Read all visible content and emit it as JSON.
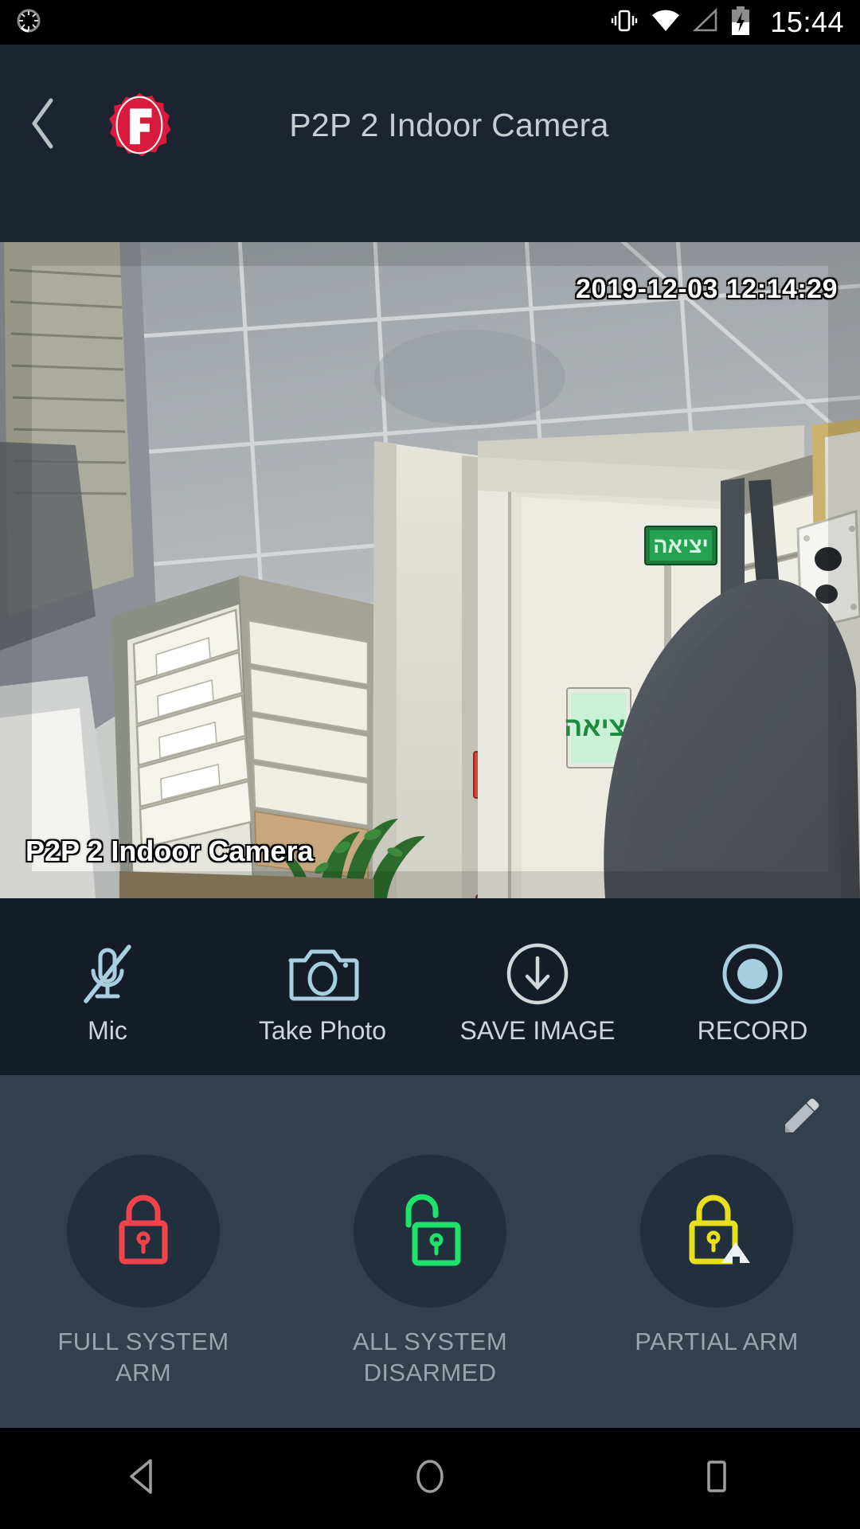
{
  "statusbar": {
    "time": "15:44",
    "icons": [
      "app-loading-icon",
      "vibrate-icon",
      "wifi-icon",
      "cellular-signal-icon",
      "battery-charging-icon"
    ]
  },
  "appbar": {
    "back_icon": "chevron-left-icon",
    "logo_letter": "F",
    "logo_name": "brand-badge-logo",
    "title": "P2P 2 Indoor Camera"
  },
  "video": {
    "timestamp": "2019-12-03 12:14:29",
    "camera_label": "P2P 2 Indoor Camera",
    "exit_sign_top": "יציאה",
    "exit_sign_lower": "יציאה"
  },
  "toolbar": {
    "items": [
      {
        "label": "Mic",
        "icon": "mic-off-icon",
        "color": "#a8cfe0"
      },
      {
        "label": "Take Photo",
        "icon": "camera-icon",
        "color": "#a8cfe0"
      },
      {
        "label": "SAVE IMAGE",
        "icon": "download-circle-icon",
        "color": "#d2d6da"
      },
      {
        "label": "RECORD",
        "icon": "record-circle-icon",
        "color": "#a8cfe0"
      }
    ]
  },
  "armpanel": {
    "edit_icon": "pencil-edit-icon",
    "buttons": [
      {
        "label": "FULL SYSTEM ARM",
        "icon": "lock-closed-icon",
        "color": "#f2434a"
      },
      {
        "label": "ALL SYSTEM DISARMED",
        "icon": "lock-open-icon",
        "color": "#1fe26a"
      },
      {
        "label": "PARTIAL ARM",
        "icon": "lock-home-icon",
        "color": "#e8e01d"
      }
    ]
  },
  "navbar": {
    "back_label": "back-triangle-icon",
    "home_label": "home-circle-icon",
    "recents_label": "recents-square-icon"
  },
  "colors": {
    "appbar_bg": "#1b2430",
    "toolbar_bg": "#141d27",
    "armpanel_bg": "#323f4c",
    "arm_circle_bg": "#22303d",
    "accent_blue": "#a8cfe0",
    "brand_red": "#d81a3c"
  }
}
